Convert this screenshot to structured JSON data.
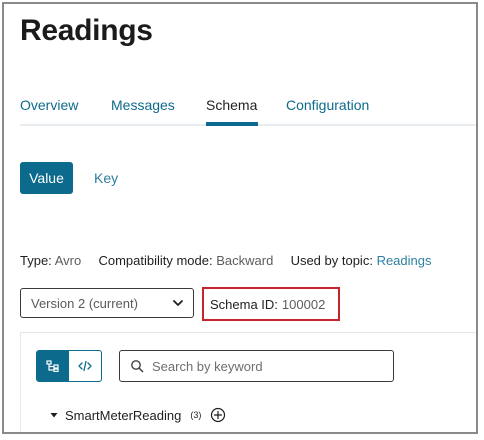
{
  "page": {
    "title": "Readings"
  },
  "tabs": [
    {
      "label": "Overview",
      "active": false
    },
    {
      "label": "Messages",
      "active": false
    },
    {
      "label": "Schema",
      "active": true
    },
    {
      "label": "Configuration",
      "active": false
    }
  ],
  "segment": {
    "value_label": "Value",
    "key_label": "Key",
    "selected": "Value"
  },
  "meta": {
    "type_label": "Type:",
    "type_value": "Avro",
    "compat_label": "Compatibility mode:",
    "compat_value": "Backward",
    "used_label": "Used by topic:",
    "used_value": "Readings"
  },
  "version_select": {
    "value": "Version 2 (current)",
    "chevron_icon": "chevron-down-icon"
  },
  "schema_id": {
    "label": "Schema ID:",
    "value": "100002",
    "highlight_color": "#c4262e"
  },
  "view_toggle": {
    "tree_icon": "tree-view-icon",
    "code_icon": "code-view-icon",
    "selected": "tree"
  },
  "search": {
    "placeholder": "Search by keyword",
    "value": "",
    "icon": "search-icon"
  },
  "tree": {
    "root_name": "SmartMeterReading",
    "root_count": "(3)",
    "expanded": true,
    "add_icon": "add-circle-icon"
  },
  "colors": {
    "accent": "#0c6a8d",
    "link": "#2e7fa0",
    "highlight": "#c4262e"
  }
}
